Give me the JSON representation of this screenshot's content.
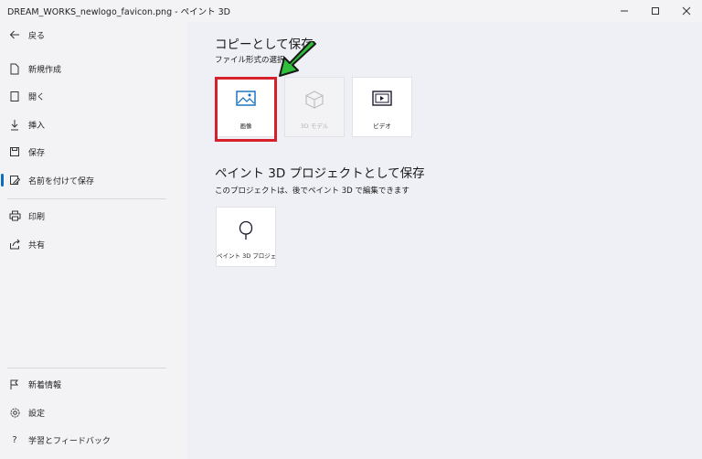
{
  "window": {
    "title": "DREAM_WORKS_newlogo_favicon.png - ペイント 3D",
    "minimize_icon": "minimize-icon",
    "maximize_icon": "maximize-icon",
    "close_icon": "close-icon"
  },
  "sidebar": {
    "back_label": "戻る",
    "items": [
      {
        "label": "新規作成",
        "icon": "new-file-icon"
      },
      {
        "label": "開く",
        "icon": "open-icon"
      },
      {
        "label": "挿入",
        "icon": "insert-icon"
      },
      {
        "label": "保存",
        "icon": "save-icon"
      },
      {
        "label": "名前を付けて保存",
        "icon": "save-as-icon",
        "active": true
      },
      {
        "label": "印刷",
        "icon": "print-icon"
      },
      {
        "label": "共有",
        "icon": "share-icon"
      }
    ],
    "bottom_items": [
      {
        "label": "新着情報",
        "icon": "flag-icon"
      },
      {
        "label": "設定",
        "icon": "gear-icon"
      },
      {
        "label": "学習とフィードバック",
        "icon": "help-icon"
      }
    ]
  },
  "main": {
    "copy_section": {
      "heading": "コピーとして保存",
      "subheading": "ファイル形式の選択",
      "tiles": [
        {
          "label": "画像",
          "icon": "image-icon",
          "enabled": true
        },
        {
          "label": "3D モデル",
          "icon": "3d-model-icon",
          "enabled": false
        },
        {
          "label": "ビデオ",
          "icon": "video-icon",
          "enabled": true
        }
      ]
    },
    "project_section": {
      "heading": "ペイント 3D プロジェクトとして保存",
      "subheading": "このプロジェクトは、後でペイント 3D で編集できます",
      "tiles": [
        {
          "label": "ペイント 3D プロジェ...",
          "icon": "paint3d-project-icon"
        }
      ]
    }
  },
  "colors": {
    "accent": "#0f6cbd",
    "highlight_box": "#d6202c",
    "arrow": "#2fbf3a"
  }
}
